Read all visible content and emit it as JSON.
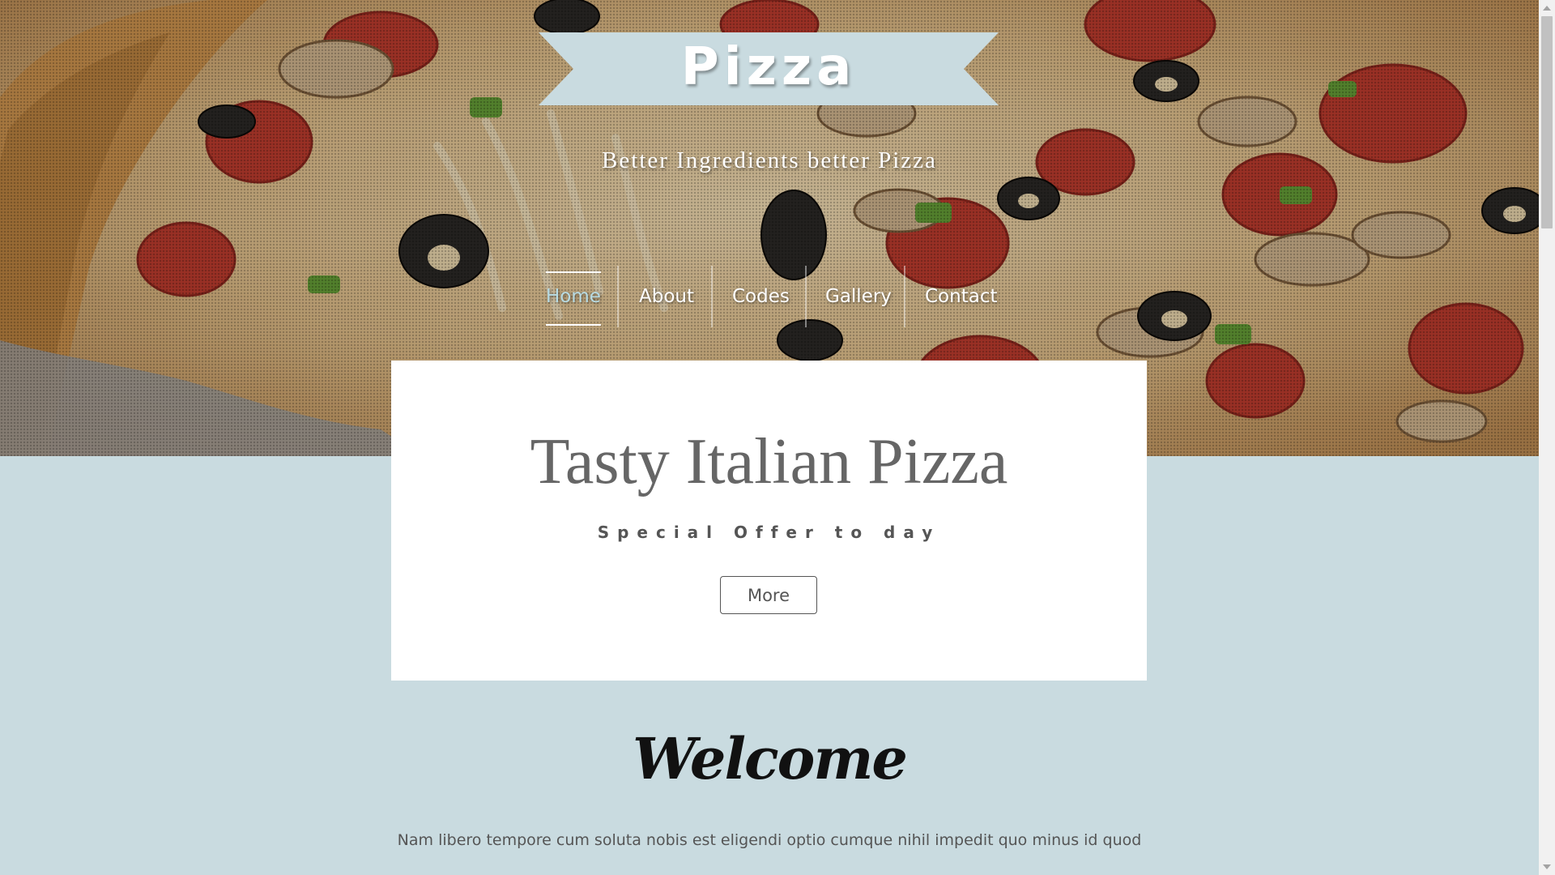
{
  "colors": {
    "ribbon": "#c9dbe0",
    "page_background": "#c9dbe0",
    "nav_active": "#b8dbe3",
    "card_background": "#ffffff"
  },
  "header": {
    "logo": "Pizza",
    "tagline": "Better Ingredients better Pizza"
  },
  "nav": {
    "items": [
      {
        "label": "Home",
        "active": true
      },
      {
        "label": "About"
      },
      {
        "label": "Codes"
      },
      {
        "label": "Gallery"
      },
      {
        "label": "Contact"
      }
    ]
  },
  "offer": {
    "title": "Tasty Italian Pizza",
    "subtitle": "Special Offer to day",
    "button": "More"
  },
  "welcome": {
    "heading": "Welcome",
    "text": "Nam libero tempore cum soluta nobis est eligendi optio cumque nihil impedit quo minus id quod"
  },
  "icons": [
    "scroll-up-arrow-icon",
    "scroll-down-arrow-icon",
    "ribbon-banner"
  ]
}
